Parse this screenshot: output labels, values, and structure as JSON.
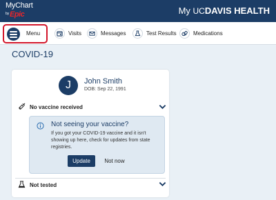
{
  "header": {
    "logo_text": "MyChart",
    "logo_by": "by",
    "logo_brand": "Epic",
    "brand_prefix": "My ",
    "brand_uc": "UC",
    "brand_name": "DAVIS HEALTH"
  },
  "nav": {
    "menu_label": "Menu",
    "items": [
      {
        "label": "Visits",
        "icon": "calendar-icon"
      },
      {
        "label": "Messages",
        "icon": "envelope-icon"
      },
      {
        "label": "Test Results",
        "icon": "flask-icon"
      },
      {
        "label": "Medications",
        "icon": "pill-icon"
      }
    ]
  },
  "page": {
    "title": "COVID-19"
  },
  "patient": {
    "initial": "J",
    "name": "John Smith",
    "dob": "DOB: Sep 22, 1991"
  },
  "vaccine": {
    "status": "No vaccine received",
    "alert_title": "Not seeing your vaccine?",
    "alert_text": "If you got your COVID-19 vaccine and it isn't showing up here, check for updates from state registries.",
    "update_button": "Update",
    "not_now_button": "Not now"
  },
  "testing": {
    "status": "Not tested"
  },
  "colors": {
    "navy": "#1c3d66",
    "menu_outline": "#d3152a",
    "epic_red": "#e8262b",
    "page_bg": "#e9f0f6",
    "alert_bg": "#dfe9f2"
  }
}
